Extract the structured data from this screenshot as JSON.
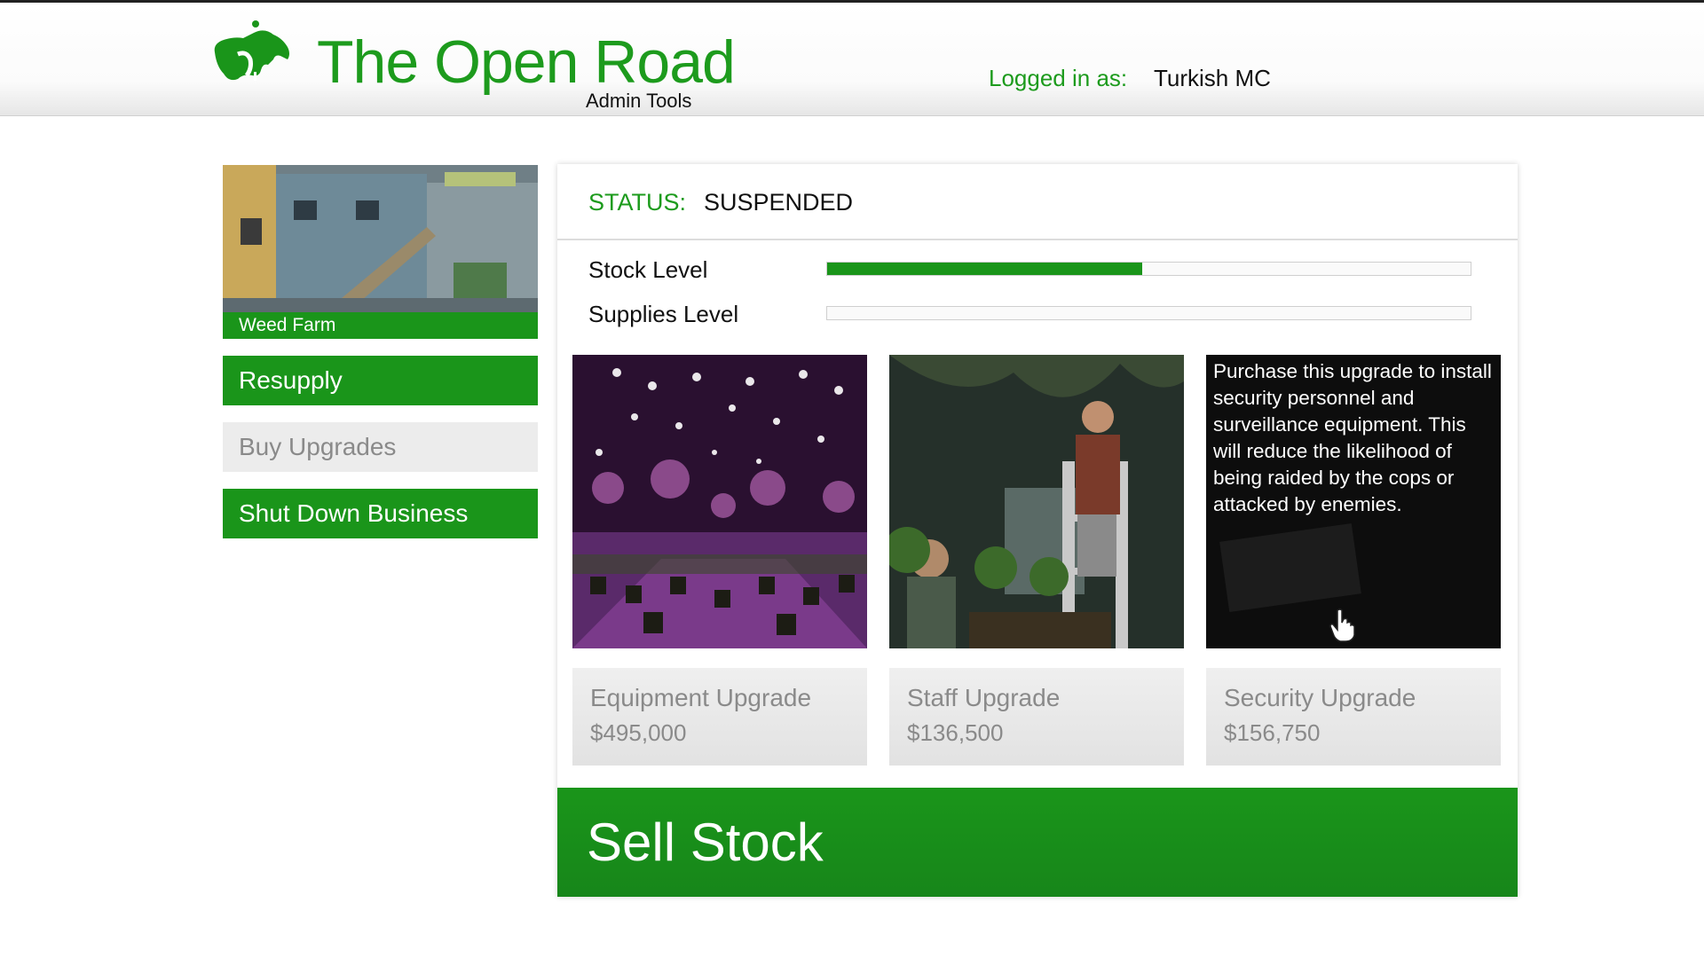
{
  "header": {
    "brand_title": "The Open Road",
    "brand_subtitle": "Admin Tools",
    "logged_in_label": "Logged in as:",
    "logged_in_user": "Turkish MC"
  },
  "sidebar": {
    "thumbnail_caption": "Weed Farm",
    "buttons": [
      "Resupply",
      "Buy Upgrades",
      "Shut Down Business"
    ]
  },
  "status": {
    "label": "STATUS:",
    "value": "SUSPENDED"
  },
  "meters": [
    {
      "label": "Stock Level",
      "fill": 0.49
    },
    {
      "label": "Supplies Level",
      "fill": 0.0
    }
  ],
  "upgrades": [
    {
      "name": "Equipment Upgrade",
      "price": "$495,000"
    },
    {
      "name": "Staff Upgrade",
      "price": "$136,500"
    },
    {
      "name": "Security Upgrade",
      "price": "$156,750",
      "description": "Purchase this upgrade to install security personnel and surveillance equipment. This will reduce the likelihood of being raided by the cops or attacked by enemies."
    }
  ],
  "sell_button": "Sell Stock",
  "colors": {
    "accent": "#1a951a",
    "text_green": "#1d9b1d",
    "button_grey": "#ececec",
    "muted_text": "#8a8a8a"
  },
  "icons": [
    "open-road-logo-icon",
    "hand-cursor-icon"
  ]
}
